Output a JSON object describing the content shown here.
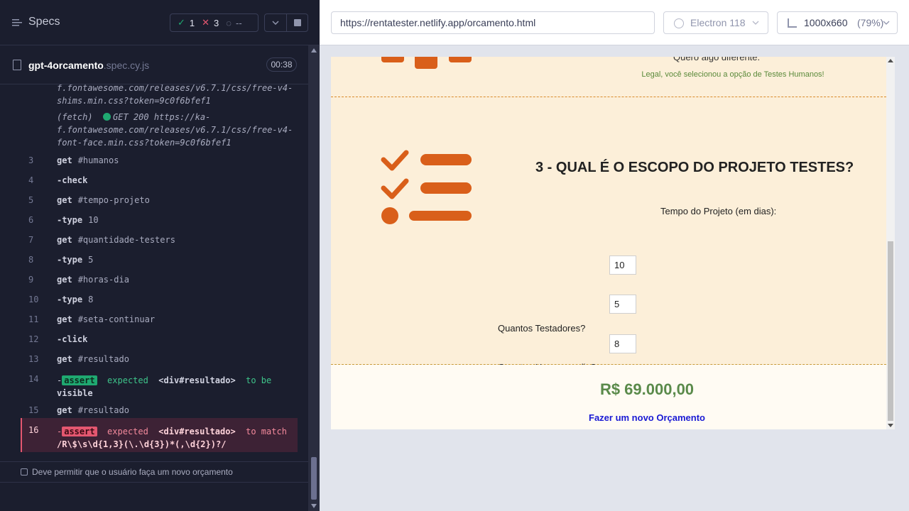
{
  "reporter": {
    "title": "Specs",
    "passed": "1",
    "failed": "3",
    "pending": "--",
    "file_name": "gpt-4orcamento",
    "file_ext": ".spec.cy.js",
    "duration": "00:38"
  },
  "log": {
    "fetch1_line1": "f.fontawesome.com/releases/v6.7.1/css/free-v4-",
    "fetch1_line2": "shims.min.css?token=9c0f6bfef1",
    "fetch2_prefix": "(fetch)",
    "fetch2_req": "GET 200 https://ka-",
    "fetch2_line2": "f.fontawesome.com/releases/v6.7.1/css/free-v4-",
    "fetch2_line3": "font-face.min.css?token=9c0f6bfef1",
    "rows": [
      {
        "num": "3",
        "cmd": "get",
        "arg": "#humanos"
      },
      {
        "num": "4",
        "cmd": "-check",
        "arg": ""
      },
      {
        "num": "5",
        "cmd": "get",
        "arg": "#tempo-projeto"
      },
      {
        "num": "6",
        "cmd": "-type",
        "arg": "10"
      },
      {
        "num": "7",
        "cmd": "get",
        "arg": "#quantidade-testers"
      },
      {
        "num": "8",
        "cmd": "-type",
        "arg": "5"
      },
      {
        "num": "9",
        "cmd": "get",
        "arg": "#horas-dia"
      },
      {
        "num": "10",
        "cmd": "-type",
        "arg": "8"
      },
      {
        "num": "11",
        "cmd": "get",
        "arg": "#seta-continuar"
      },
      {
        "num": "12",
        "cmd": "-click",
        "arg": ""
      },
      {
        "num": "13",
        "cmd": "get",
        "arg": "#resultado"
      }
    ],
    "row14": {
      "num": "14",
      "badge": "assert",
      "expected": "expected",
      "subject": "<div#resultado>",
      "verb": "to be",
      "tail": "visible"
    },
    "row15": {
      "num": "15",
      "cmd": "get",
      "arg": "#resultado"
    },
    "row16": {
      "num": "16",
      "badge": "assert",
      "expected": "expected",
      "subject": "<div#resultado>",
      "verb": "to match",
      "tail": "/R\\$\\s\\d{1,3}(\\.\\d{3})*(,\\d{2})?/"
    }
  },
  "test_title": "Deve permitir que o usuário faça um novo orçamento",
  "browser": {
    "url": "https://rentatester.netlify.app/orcamento.html",
    "name": "Electron 118",
    "viewport": "1000x660",
    "zoom": "(79%)"
  },
  "app": {
    "other_option": "Quero algo diferente.",
    "selected_msg": "Legal, você selecionou a opção de Testes Humanos!",
    "q3_title": "3 - QUAL É O ESCOPO DO PROJETO TESTES?",
    "label_tempo": "Tempo do Projeto (em dias):",
    "tempo_value": "10",
    "label_testers": "Quantos Testadores?",
    "testers_value": "5",
    "label_horas": "Quantas Horas por dia?",
    "horas_value": "8",
    "result": "R$ 69.000,00",
    "new_quote": "Fazer um novo Orçamento"
  },
  "colors": {
    "pass": "#1fa971",
    "fail": "#e45770",
    "accent_orange": "#d95f1a"
  }
}
